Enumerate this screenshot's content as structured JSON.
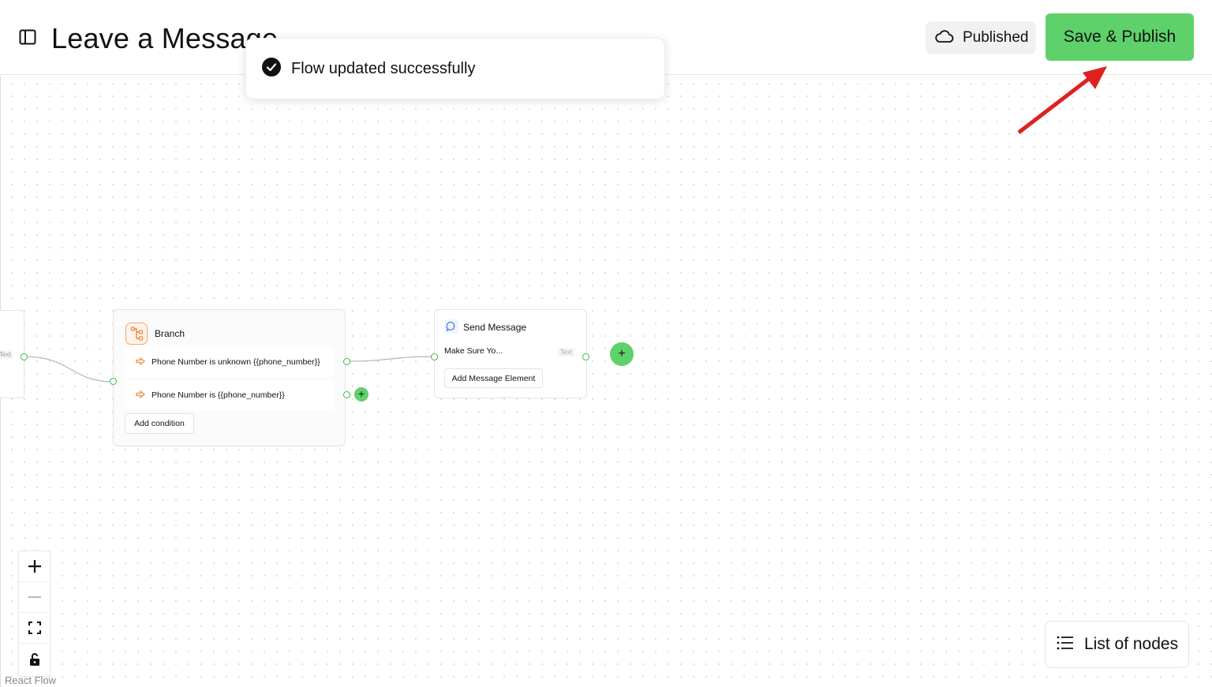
{
  "header": {
    "title": "Leave a Message",
    "status_label": "Published",
    "save_label": "Save & Publish"
  },
  "toast": {
    "message": "Flow updated successfully"
  },
  "canvas": {
    "prev_node": {
      "tag": "Text"
    },
    "branch_node": {
      "title": "Branch",
      "conditions": [
        {
          "text": "Phone Number is unknown {{phone_number}}"
        },
        {
          "text": "Phone Number is {{phone_number}}"
        }
      ],
      "add_condition_label": "Add condition"
    },
    "send_node": {
      "title": "Send Message",
      "message_preview": "Make Sure Yo...",
      "message_tag": "Text",
      "add_element_label": "Add Message Element"
    },
    "add_node_symbol": "+"
  },
  "controls": [
    "zoom-in",
    "zoom-out",
    "fit-view",
    "lock"
  ],
  "attribution": "React Flow",
  "list_nodes_label": "List of nodes",
  "colors": {
    "accent": "#5ed16a",
    "annotation_arrow": "#e02020",
    "branch_icon": "#f08a3c"
  }
}
